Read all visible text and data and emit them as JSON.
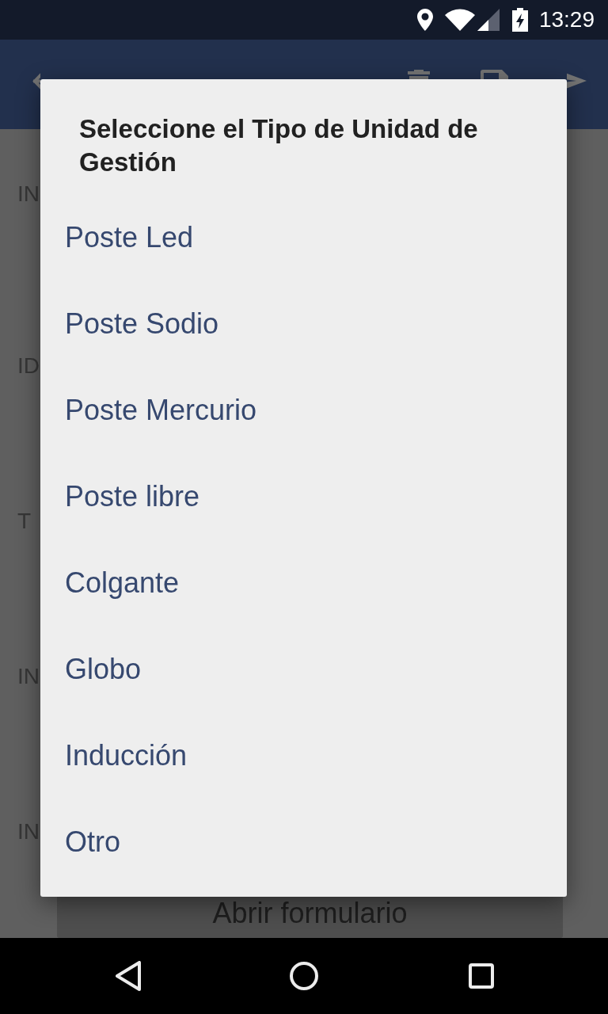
{
  "status_bar": {
    "time": "13:29"
  },
  "form": {
    "fields": [
      {
        "label": "IN"
      },
      {
        "label": "ID"
      },
      {
        "label": "T"
      },
      {
        "label": "IN"
      },
      {
        "label": "IN"
      }
    ],
    "button": "Abrir formulario"
  },
  "dialog": {
    "title": "Seleccione el Tipo de Unidad de Gestión",
    "options": [
      "Poste Led",
      "Poste Sodio",
      "Poste Mercurio",
      "Poste libre",
      "Colgante",
      "Globo",
      "Inducción",
      "Otro"
    ]
  }
}
